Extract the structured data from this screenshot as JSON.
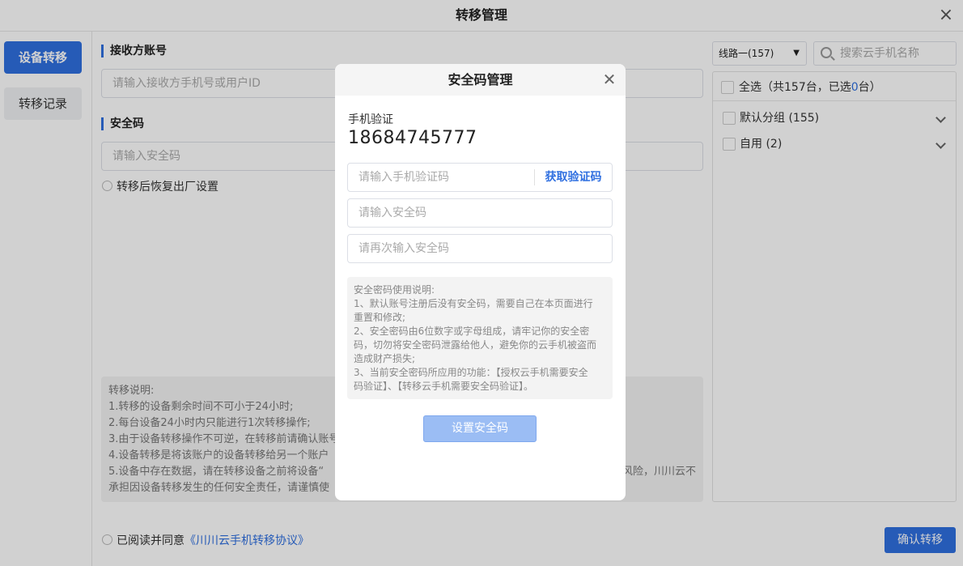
{
  "window": {
    "title": "转移管理"
  },
  "sidebar": {
    "items": [
      {
        "label": "设备转移"
      },
      {
        "label": "转移记录"
      }
    ]
  },
  "form": {
    "receiver_label": "接收方账号",
    "receiver_placeholder": "请输入接收方手机号或用户ID",
    "security_label": "安全码",
    "security_placeholder": "请输入安全码",
    "factory_reset_label": "转移后恢复出厂设置"
  },
  "notes": {
    "lines": [
      "转移说明:",
      "1.转移的设备剩余时间不可小于24小时;",
      "2.每台设备24小时内只能进行1次转移操作;",
      "3.由于设备转移操作不可逆，在转移前请确认账号",
      "4.设备转移是将该账户的设备转移给另一个账户",
      "5.设备中存在数据，请在转移设备之前将设备“",
      "承担因设备转移发生的任何安全责任，请谨慎使"
    ],
    "tail_line5": "风险，川川云不"
  },
  "agreement": {
    "text": "已阅读并同意",
    "link": "《川川云手机转移协议》"
  },
  "confirm_label": "确认转移",
  "right": {
    "line_select": "线路一(157)",
    "search_placeholder": "搜索云手机名称",
    "select_all_prefix": "全选（共157台，已选",
    "select_all_count": "0",
    "select_all_suffix": "台）",
    "groups": [
      {
        "label": "默认分组 (155)"
      },
      {
        "label": "自用 (2)"
      }
    ]
  },
  "modal": {
    "title": "安全码管理",
    "phone_label": "手机验证",
    "phone": "18684745777",
    "sms_placeholder": "请输入手机验证码",
    "get_code": "获取验证码",
    "code_placeholder": "请输入安全码",
    "code_again_placeholder": "请再次输入安全码",
    "desc_lines": [
      "安全密码使用说明:",
      "1、默认账号注册后没有安全码，需要自己在本页面进行",
      "重置和修改;",
      "2、安全密码由6位数字或字母组成，请牢记你的安全密",
      "码，切勿将安全密码泄露给他人，避免你的云手机被盗而",
      "造成财产损失;",
      "3、当前安全密码所应用的功能：【授权云手机需要安全",
      "码验证】、【转移云手机需要安全码验证】。"
    ],
    "submit": "设置安全码"
  },
  "colors": {
    "accent": "#2f6fe0",
    "submit_disabled": "#9bbdf4"
  }
}
